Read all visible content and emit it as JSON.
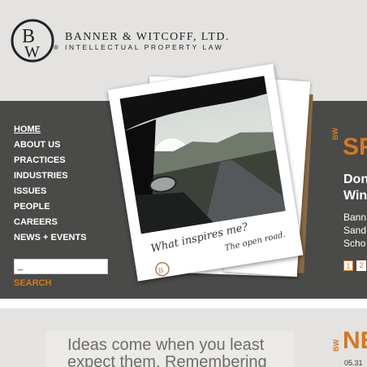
{
  "header": {
    "logo_text": "BW",
    "firm_name": "BANNER & WITCOFF, LTD.",
    "firm_subtitle": "INTELLECTUAL PROPERTY LAW",
    "registered_mark": "®"
  },
  "nav": {
    "items": [
      {
        "label": "HOME",
        "active": true
      },
      {
        "label": "ABOUT US"
      },
      {
        "label": "PRACTICES"
      },
      {
        "label": "INDUSTRIES"
      },
      {
        "label": "ISSUES"
      },
      {
        "label": "PEOPLE"
      },
      {
        "label": "CAREERS"
      },
      {
        "label": "NEWS + EVENTS"
      }
    ]
  },
  "search": {
    "value": "_",
    "button_label": "SEARCH"
  },
  "hero": {
    "caption_main": "What inspires me?",
    "caption_sub": "The open road."
  },
  "feature": {
    "tag": "BW",
    "title": "SF",
    "heading_line1": "Don",
    "heading_line2": "Win",
    "body_line1": "Bann",
    "body_line2": "Sand",
    "body_line3": "Scho",
    "pages": [
      "1",
      "2"
    ]
  },
  "bottom": {
    "quote_line1": "Ideas come when you least",
    "quote_line2": "expect them. Remembering",
    "news_tag": "BW",
    "news_title": "NE",
    "news_date": "05.31"
  },
  "colors": {
    "accent": "#d27a22",
    "band": "#4a4a48",
    "background": "#e4e3e1"
  }
}
